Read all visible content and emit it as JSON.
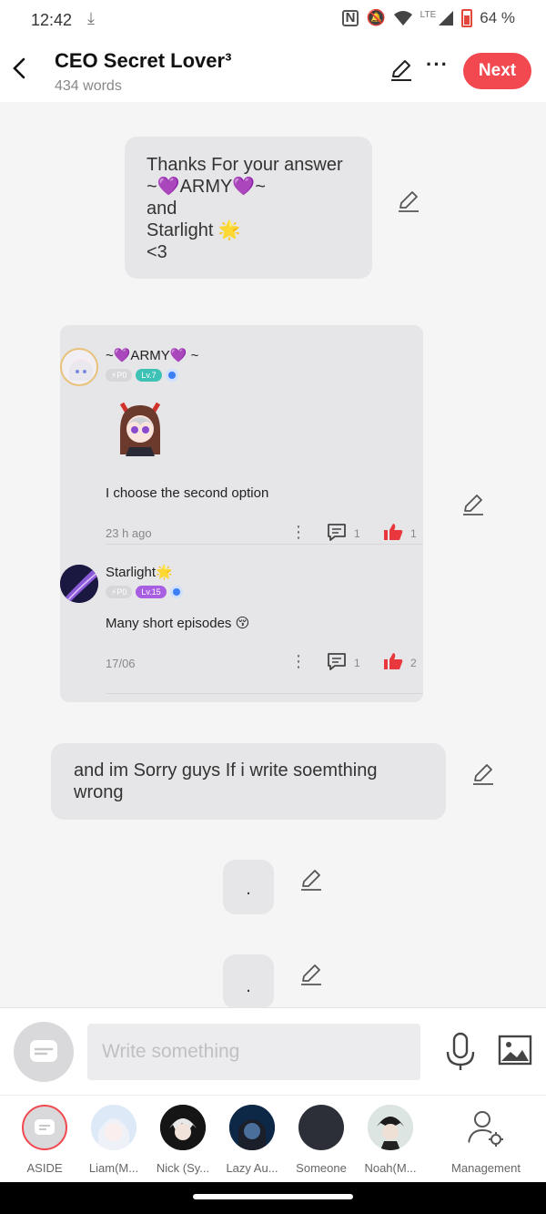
{
  "status": {
    "time": "12:42",
    "battery": "64 %",
    "network": "LTE"
  },
  "header": {
    "title": "CEO Secret Lover³",
    "subtitle": "434 words",
    "next_label": "Next",
    "more_label": "···",
    "back_icon": "chevron-left-icon"
  },
  "bubbles": {
    "first": [
      "Thanks For your answer",
      "~💜ARMY💜~",
      "and",
      "Starlight 🌟",
      "<3"
    ],
    "second": "and im Sorry guys If i write soemthing wrong",
    "third": ".",
    "fourth": "."
  },
  "comments": [
    {
      "user": "~💜ARMY💜 ~",
      "p_badge": "⚡P0",
      "level": "Lv.7",
      "text": "I choose the second option",
      "time": "23 h ago",
      "replies": "1",
      "likes": "1"
    },
    {
      "user": "Starlight🌟",
      "p_badge": "⚡P0",
      "level": "Lv.15",
      "text": "Many short episodes 😚",
      "time": "17/06",
      "replies": "1",
      "likes": "2"
    }
  ],
  "input": {
    "placeholder": "Write something"
  },
  "characters": [
    {
      "label": "ASIDE"
    },
    {
      "label": "Liam(M..."
    },
    {
      "label": "Nick (Sy..."
    },
    {
      "label": "Lazy Au..."
    },
    {
      "label": "Someone"
    },
    {
      "label": "Noah(M..."
    },
    {
      "label": "Management"
    }
  ],
  "colors": {
    "accent": "#f2484f",
    "bubble": "#e6e6e8",
    "like": "#e8383d"
  }
}
